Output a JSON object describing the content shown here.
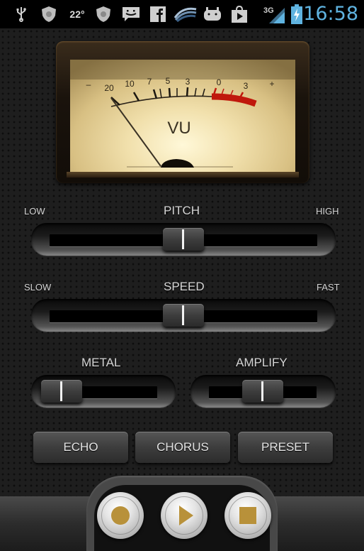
{
  "status_bar": {
    "icons": [
      "usb-icon",
      "shield-app-icon",
      "temperature-text",
      "shield-app-icon",
      "messaging-icon",
      "facebook-icon",
      "swiftkey-icon",
      "android-icon",
      "play-store-icon",
      "signal-3g-icon",
      "battery-charging-icon"
    ],
    "temperature": "22°",
    "network": "3G",
    "time": "16:58",
    "time_color": "#5fb3e0"
  },
  "vu_meter": {
    "label": "VU",
    "scale_labels": [
      "–",
      "20",
      "10",
      "7",
      "5",
      "3",
      "0",
      "3",
      "+"
    ],
    "needle_level_db": -20,
    "red_zone_color": "#c0180c"
  },
  "pitch": {
    "title": "PITCH",
    "min_label": "LOW",
    "max_label": "HIGH",
    "value": 0.5
  },
  "speed": {
    "title": "SPEED",
    "min_label": "SLOW",
    "max_label": "FAST",
    "value": 0.5
  },
  "metal": {
    "title": "METAL",
    "value": 0.0
  },
  "amplify": {
    "title": "AMPLIFY",
    "value": 0.5
  },
  "effects": {
    "echo": "ECHO",
    "chorus": "CHORUS",
    "preset": "PRESET"
  },
  "transport": {
    "record": "record-icon",
    "play": "play-icon",
    "stop": "stop-icon",
    "glyph_color": "#b8913a"
  }
}
